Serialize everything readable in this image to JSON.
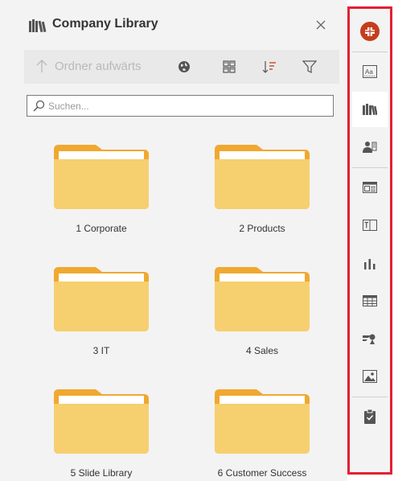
{
  "panel": {
    "title": "Company Library",
    "toolbar": {
      "up_label": "Ordner aufwärts"
    },
    "search": {
      "placeholder": "Suchen..."
    },
    "folders": [
      {
        "label": "1 Corporate"
      },
      {
        "label": "2 Products"
      },
      {
        "label": "3 IT"
      },
      {
        "label": "4 Sales"
      },
      {
        "label": "5 Slide Library"
      },
      {
        "label": "6 Customer Success"
      }
    ]
  },
  "rail": {
    "items": [
      {
        "icon": "add-in-logo-icon"
      },
      {
        "icon": "font-style-icon"
      },
      {
        "icon": "library-books-icon",
        "active": true
      },
      {
        "icon": "people-icon"
      },
      {
        "icon": "layout-icon"
      },
      {
        "icon": "text-box-icon"
      },
      {
        "icon": "bar-chart-icon"
      },
      {
        "icon": "table-icon"
      },
      {
        "icon": "icons-shapes-icon"
      },
      {
        "icon": "picture-icon"
      },
      {
        "icon": "clipboard-check-icon"
      }
    ]
  },
  "colors": {
    "accent": "#c43e1c",
    "highlight_border": "#e51f33",
    "folder_front": "#f6cf6f",
    "folder_back": "#f0a830"
  }
}
